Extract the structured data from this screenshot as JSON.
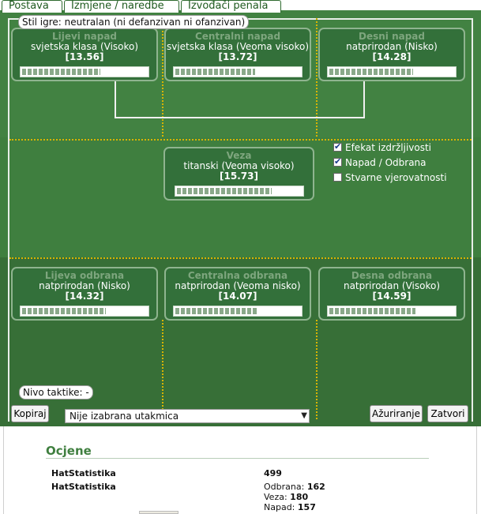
{
  "tabs": [
    "Postava",
    "Izmjene / naredbe",
    "Izvođači penala"
  ],
  "style_label": "Stil igre: neutralan (ni defanzivan ni ofanzivan)",
  "tactic_label": "Nivo taktike: -",
  "boxes": {
    "left_attack": {
      "title": "Lijevi napad",
      "rating": "svjetska klasa (Visoko)",
      "value": "[13.56]",
      "bar_fill": 0.62
    },
    "center_attack": {
      "title": "Centralni napad",
      "rating": "svjetska klasa (Veoma visoko)",
      "value": "[13.72]",
      "bar_fill": 0.63
    },
    "right_attack": {
      "title": "Desni napad",
      "rating": "natprirodan (Nisko)",
      "value": "[14.28]",
      "bar_fill": 0.66
    },
    "midfield": {
      "title": "Veza",
      "rating": "titanski (Veoma visoko)",
      "value": "[15.73]",
      "bar_fill": 0.75
    },
    "left_defense": {
      "title": "Lijeva odbrana",
      "rating": "natprirodan (Nisko)",
      "value": "[14.32]",
      "bar_fill": 0.66
    },
    "center_defense": {
      "title": "Centralna odbrana",
      "rating": "natprirodan (Veoma nisko)",
      "value": "[14.07]",
      "bar_fill": 0.65
    },
    "right_defense": {
      "title": "Desna odbrana",
      "rating": "natprirodan (Visoko)",
      "value": "[14.59]",
      "bar_fill": 0.68
    }
  },
  "checkboxes": [
    {
      "label": "Efekat izdržljivosti",
      "checked": true
    },
    {
      "label": "Napad / Odbrana",
      "checked": true
    },
    {
      "label": "Stvarne vjerovatnosti",
      "checked": false
    }
  ],
  "buttons": {
    "copy": "Kopiraj",
    "update": "Ažuriranje",
    "close": "Zatvori"
  },
  "match_select": {
    "value": "Nije izabrana utakmica"
  },
  "ratings": {
    "heading": "Ocjene",
    "row1": {
      "label": "HatStatistika",
      "value": "499"
    },
    "row2": {
      "label": "HatStatistika",
      "lines": [
        {
          "label": "Odbrana:",
          "value": "162"
        },
        {
          "label": "Veza:",
          "value": "180"
        },
        {
          "label": "Napad:",
          "value": "157"
        }
      ]
    }
  }
}
